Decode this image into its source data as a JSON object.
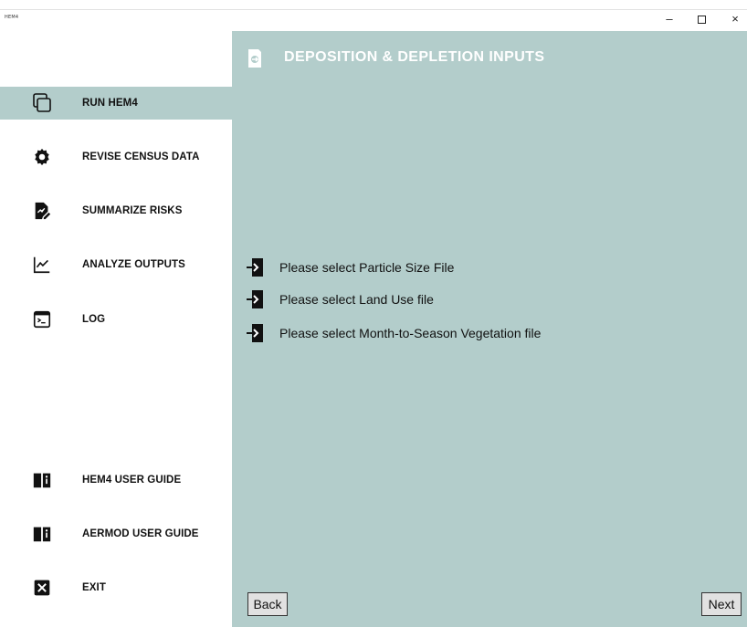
{
  "window": {
    "app_title": "HEM4",
    "minimize": "–",
    "close": "×"
  },
  "sidebar": {
    "items": [
      {
        "label": "RUN HEM4",
        "icon": "copy-icon",
        "active": true
      },
      {
        "label": "REVISE CENSUS DATA",
        "icon": "gear-icon",
        "active": false
      },
      {
        "label": "SUMMARIZE RISKS",
        "icon": "file-edit-icon",
        "active": false
      },
      {
        "label": "ANALYZE OUTPUTS",
        "icon": "line-chart-icon",
        "active": false
      },
      {
        "label": "LOG",
        "icon": "terminal-icon",
        "active": false
      },
      {
        "label": "HEM4 USER GUIDE",
        "icon": "book-info-icon",
        "active": false
      },
      {
        "label": "AERMOD USER GUIDE",
        "icon": "book-info-icon",
        "active": false
      },
      {
        "label": "EXIT",
        "icon": "close-box-icon",
        "active": false
      }
    ]
  },
  "main": {
    "title": "DEPOSITION & DEPLETION INPUTS",
    "title_icon": "file-import-icon",
    "file_selectors": [
      {
        "label": "Please select Particle Size File",
        "icon": "file-import-icon"
      },
      {
        "label": "Please select Land Use file",
        "icon": "file-import-icon"
      },
      {
        "label": "Please select Month-to-Season Vegetation file",
        "icon": "file-import-icon"
      }
    ],
    "back_label": "Back",
    "next_label": "Next"
  },
  "colors": {
    "panel_bg": "#b3cdcb",
    "title_text": "#ffffff"
  }
}
